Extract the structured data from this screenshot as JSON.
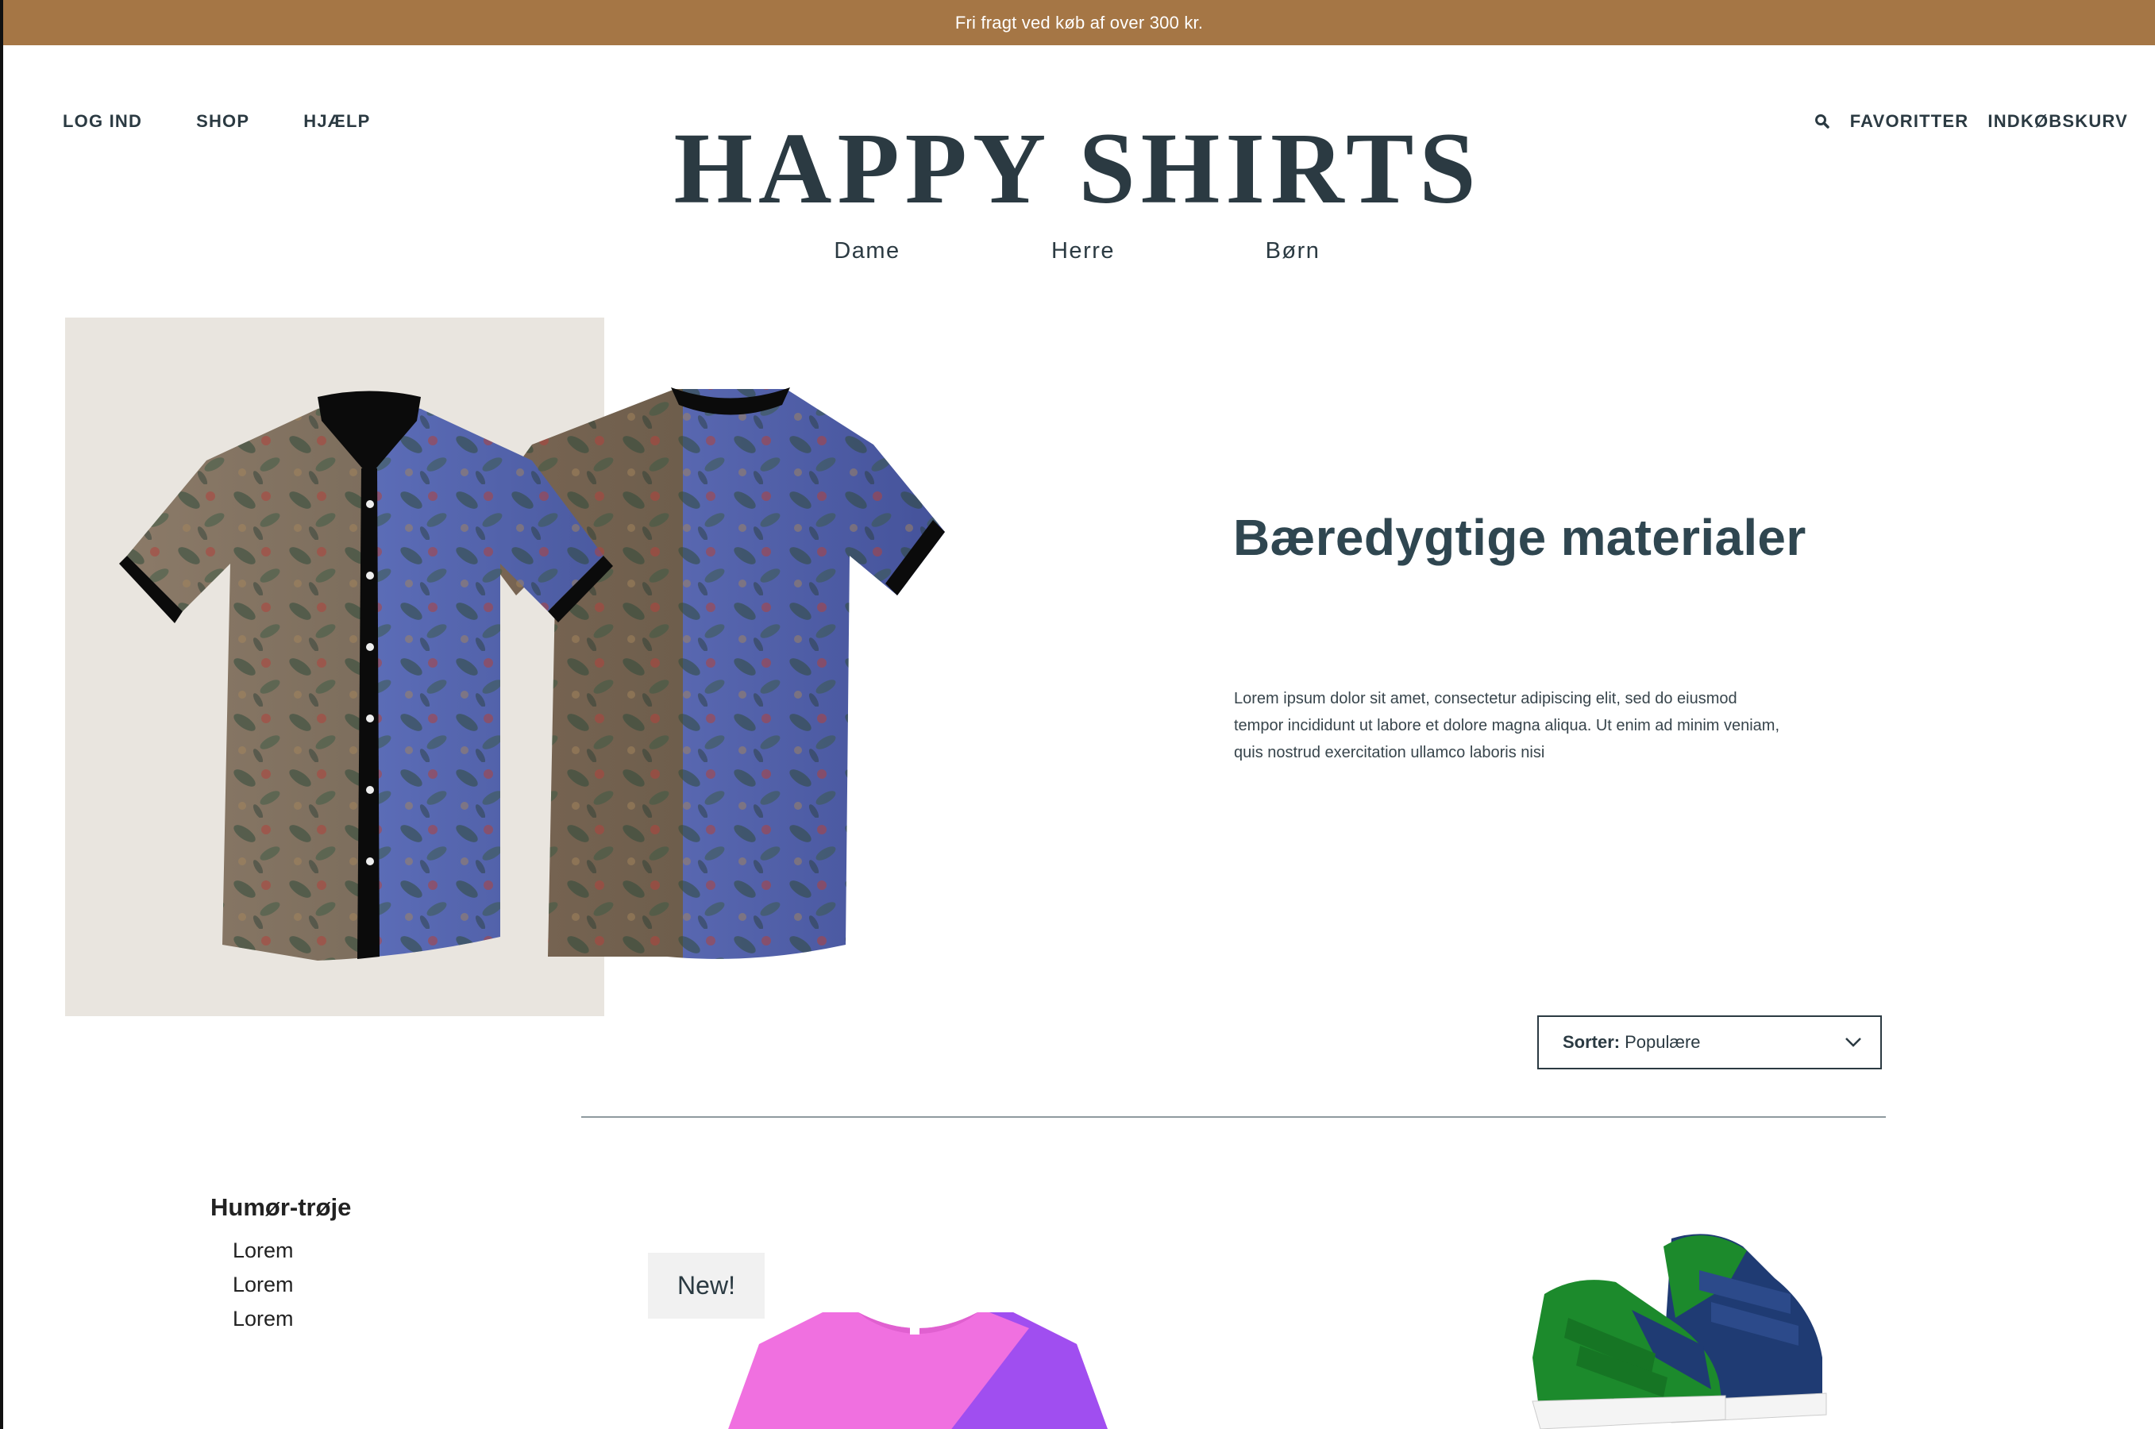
{
  "promo": {
    "text": "Fri fragt ved køb af over 300 kr."
  },
  "nav_left": {
    "login": "LOG IND",
    "shop": "SHOP",
    "help": "HJÆLP"
  },
  "nav_right": {
    "favorites": "FAVORITTER",
    "cart": "INDKØBSKURV"
  },
  "logo": {
    "text": "HAPPY SHIRTS"
  },
  "categories": [
    "Dame",
    "Herre",
    "Børn"
  ],
  "hero": {
    "title": "Bæredygtige materialer",
    "body": "Lorem ipsum dolor sit amet, consectetur adipiscing elit, sed do eiusmod tempor incididunt ut labore et dolore magna aliqua. Ut enim ad minim veniam, quis nostrud exercitation ullamco laboris nisi"
  },
  "sort": {
    "label": "Sorter:",
    "value": "Populære"
  },
  "filters": {
    "title": "Humør-trøje",
    "items": [
      "Lorem",
      "Lorem",
      "Lorem"
    ]
  },
  "products": {
    "badge": "New!"
  },
  "colors": {
    "promo_bg": "#a57645",
    "primary_text": "#2b3a42",
    "hero_panel": "#e9e5df",
    "badge_bg": "#f1f1f1"
  },
  "icons": [
    "search-icon",
    "chevron-down-icon"
  ]
}
